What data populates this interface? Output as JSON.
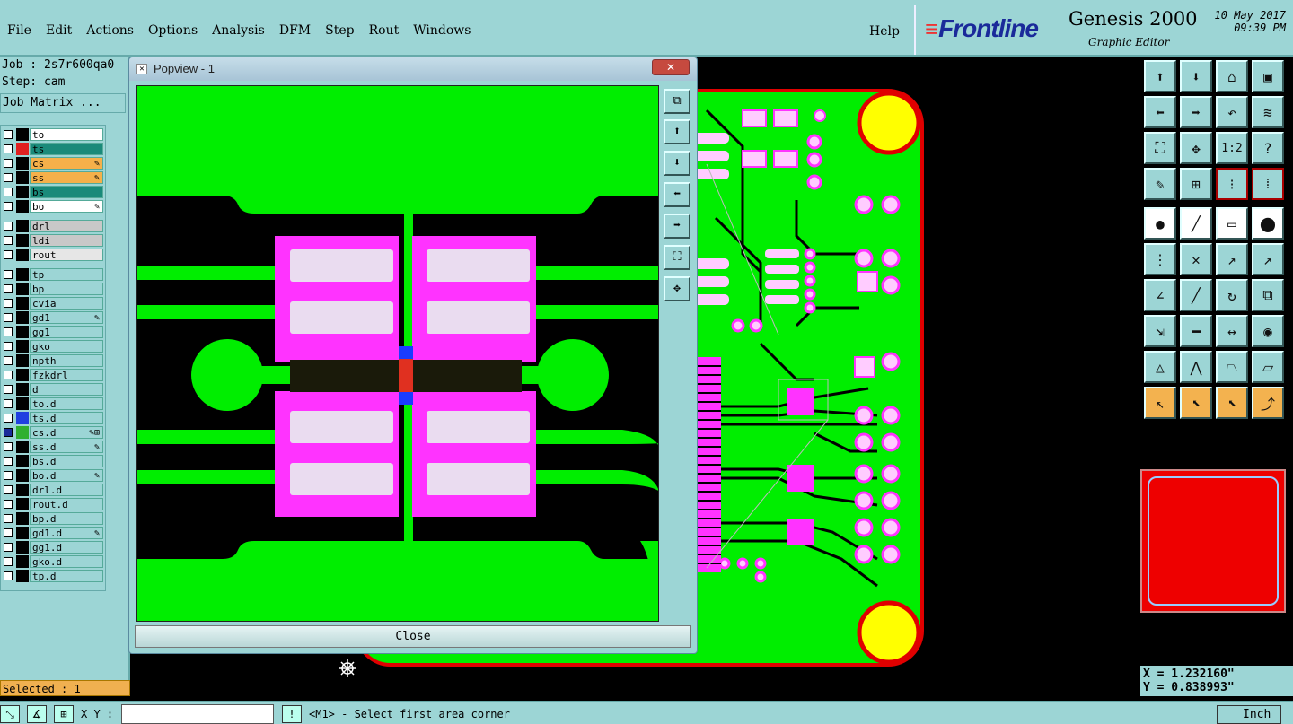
{
  "menu": {
    "items": [
      "File",
      "Edit",
      "Actions",
      "Options",
      "Analysis",
      "DFM",
      "Step",
      "Rout",
      "Windows"
    ],
    "help": "Help"
  },
  "brand": {
    "logo": "Frontline",
    "product": "Genesis 2000",
    "subtitle": "Graphic Editor",
    "date": "10 May 2017",
    "time": "09:39 PM"
  },
  "job": {
    "job_label": "Job : 2s7r600qa0",
    "step_label": "Step: cam",
    "matrix_button": "Job Matrix ..."
  },
  "layers": [
    {
      "name": "to",
      "style": "w",
      "swatch": ""
    },
    {
      "name": "ts",
      "style": "t",
      "swatch": "#e02020"
    },
    {
      "name": "cs",
      "style": "o",
      "swatch": "",
      "mark": "✎"
    },
    {
      "name": "ss",
      "style": "o",
      "swatch": "",
      "mark": "✎"
    },
    {
      "name": "bs",
      "style": "t",
      "swatch": ""
    },
    {
      "name": "bo",
      "style": "w",
      "swatch": "",
      "mark": "✎"
    },
    {
      "name": "drl",
      "style": "g",
      "swatch": ""
    },
    {
      "name": "ldi",
      "style": "g",
      "swatch": ""
    },
    {
      "name": "rout",
      "style": "lt",
      "swatch": ""
    },
    {
      "name": "tp",
      "style": "",
      "swatch": ""
    },
    {
      "name": "bp",
      "style": "",
      "swatch": ""
    },
    {
      "name": "cvia",
      "style": "",
      "swatch": ""
    },
    {
      "name": "gd1",
      "style": "",
      "swatch": "",
      "mark": "✎"
    },
    {
      "name": "gg1",
      "style": "",
      "swatch": ""
    },
    {
      "name": "gko",
      "style": "",
      "swatch": ""
    },
    {
      "name": "npth",
      "style": "",
      "swatch": ""
    },
    {
      "name": "fzkdrl",
      "style": "",
      "swatch": ""
    },
    {
      "name": "d",
      "style": "",
      "swatch": ""
    },
    {
      "name": "to.d",
      "style": "",
      "swatch": ""
    },
    {
      "name": "ts.d",
      "style": "",
      "swatch": "#2040e0"
    },
    {
      "name": "cs.d",
      "style": "",
      "swatch": "#30b030",
      "checked": true,
      "mark": "✎⊞"
    },
    {
      "name": "ss.d",
      "style": "",
      "swatch": "",
      "mark": "✎"
    },
    {
      "name": "bs.d",
      "style": "",
      "swatch": ""
    },
    {
      "name": "bo.d",
      "style": "",
      "swatch": "",
      "mark": "✎"
    },
    {
      "name": "drl.d",
      "style": "",
      "swatch": ""
    },
    {
      "name": "rout.d",
      "style": "",
      "swatch": ""
    },
    {
      "name": "bp.d",
      "style": "",
      "swatch": ""
    },
    {
      "name": "gd1.d",
      "style": "",
      "swatch": "",
      "mark": "✎"
    },
    {
      "name": "gg1.d",
      "style": "",
      "swatch": ""
    },
    {
      "name": "gko.d",
      "style": "",
      "swatch": ""
    },
    {
      "name": "tp.d",
      "style": "",
      "swatch": ""
    }
  ],
  "status": {
    "selected": "Selected : 1",
    "xy_label": "X Y :",
    "xy_value": "",
    "message": "<M1> - Select first area corner",
    "units": "Inch",
    "x_readout": "X = 1.232160\"",
    "y_readout": "Y = 0.838993\""
  },
  "popview": {
    "title": "Popview - 1",
    "close_label": "Close",
    "close_x": "✕"
  },
  "colors": {
    "panel": "#9cd5d5",
    "copper": "#00ee00",
    "pad": "#ff33ff",
    "highlight": "#f3b24f",
    "board_outline": "#e00000"
  }
}
